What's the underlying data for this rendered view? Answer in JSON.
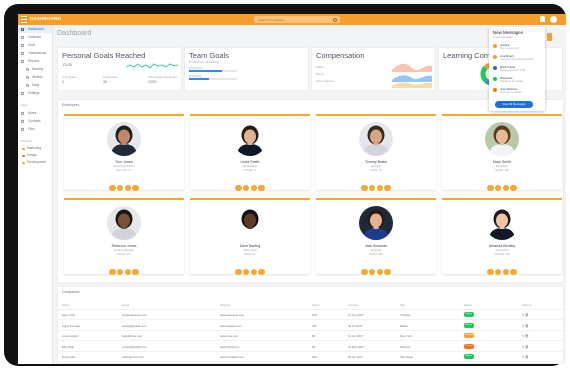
{
  "app": {
    "logo": "DASHBOARD",
    "search_placeholder": "Search for anything...",
    "page_title": "Dashboard"
  },
  "colors": {
    "accent": "#f59e2a",
    "primary": "#1d6fe0",
    "success": "#22c55e",
    "warning": "#f59e2a",
    "danger": "#f97316"
  },
  "sidebar": {
    "items": [
      {
        "label": "Dashboard",
        "icon": "home-icon"
      },
      {
        "label": "Calendar",
        "icon": "calendar-icon"
      },
      {
        "label": "Chat",
        "icon": "chat-icon"
      },
      {
        "label": "Transactions",
        "icon": "card-icon"
      },
      {
        "label": "Reports",
        "icon": "chart-icon"
      }
    ],
    "sub_items": [
      "Monthly",
      "Weekly",
      "Daily"
    ],
    "after_items": [
      {
        "label": "Settings",
        "icon": "gear-icon"
      }
    ],
    "apps_head": "Apps",
    "apps": [
      {
        "label": "Notes",
        "icon": "note-icon"
      },
      {
        "label": "Contacts",
        "icon": "contact-icon"
      },
      {
        "label": "Files",
        "icon": "file-icon"
      }
    ],
    "projects_head": "Projects",
    "projects": [
      {
        "label": "Marketing",
        "color": "#f59e2a"
      },
      {
        "label": "Design",
        "color": "#f97316"
      },
      {
        "label": "Development",
        "color": "#eab308"
      }
    ]
  },
  "kpis": {
    "goals": {
      "title": "Personal Goals Reached",
      "value": "13/35",
      "stats": [
        {
          "label": "In Progress",
          "value": "4"
        },
        {
          "label": "Total Goals",
          "value": "35"
        },
        {
          "label": "Percentage Completed",
          "value": "100%"
        }
      ]
    },
    "team": {
      "title": "Team Goals",
      "subtitle": "Production / Marketing",
      "bars": [
        {
          "label": "Production",
          "fill": 0.68
        },
        {
          "label": "Marketing",
          "fill": 0.42
        }
      ]
    },
    "compensation": {
      "title": "Compensation",
      "rows": [
        "Salary",
        "Bonus",
        "Stock Options"
      ]
    },
    "learning": {
      "title": "Learning Completed"
    }
  },
  "notifications": {
    "title": "New Messages",
    "subtitle": "5 new messages",
    "items": [
      {
        "title": "Jessica",
        "sub": "Hey, how are you?",
        "color": "#f59e2a"
      },
      {
        "title": "Lisa Brown",
        "sub": "Can you review this document?",
        "color": "#f59e2a"
      },
      {
        "title": "Mark Tomas",
        "sub": "Meeting moved to 3 PM",
        "color": "#2563eb"
      },
      {
        "title": "Stephanie",
        "sub": "Thanks for the update",
        "color": "#22c55e"
      },
      {
        "title": "Jose Martinez",
        "sub": "Let's sync tomorrow",
        "color": "#f97316"
      }
    ],
    "button": "View All Messages"
  },
  "employees": {
    "title": "Employees",
    "list": [
      {
        "name": "Tom Jones",
        "role": "Marketing Director",
        "loc": "New York, NY",
        "skin": "#c08a6a",
        "hair": "#1f1f1f",
        "shirt": "#1f2937",
        "bg": "#e5e7eb"
      },
      {
        "name": "Linda Smith",
        "role": "HR Manager",
        "loc": "Chicago, IL",
        "skin": "#e0b291",
        "hair": "#2b1b12",
        "shirt": "#0f172a",
        "bg": "#ffffff"
      },
      {
        "name": "Tommy Brake",
        "role": "Designer",
        "loc": "Austin, TX",
        "skin": "#d6a585",
        "hair": "#3b2a1e",
        "shirt": "#d1d5db",
        "bg": "#e5e7eb"
      },
      {
        "name": "Mary Smith",
        "role": "Developer",
        "loc": "Seattle, WA",
        "skin": "#e7b995",
        "hair": "#5b3a22",
        "shirt": "#f3f4f6",
        "bg": "#b7c9a6"
      },
      {
        "name": "Rebecca Jones",
        "role": "Product Manager",
        "loc": "Denver, CO",
        "skin": "#7b5238",
        "hair": "#171717",
        "shirt": "#d1d5db",
        "bg": "#e5e7eb"
      },
      {
        "name": "Dave Barling",
        "role": "Sales Lead",
        "loc": "Miami, FL",
        "skin": "#5e3a26",
        "hair": "#111111",
        "shirt": "#ffffff",
        "bg": "#ffffff"
      },
      {
        "name": "Jack Bowman",
        "role": "Engineer",
        "loc": "Boston, MA",
        "skin": "#e2b293",
        "hair": "#2b1b12",
        "shirt": "#1e3a8a",
        "bg": "#1f2937"
      },
      {
        "name": "Amanda Bentley",
        "role": "Accountant",
        "loc": "Portland, OR",
        "skin": "#efc3a4",
        "hair": "#1a1a1a",
        "shirt": "#111827",
        "bg": "#ffffff"
      }
    ]
  },
  "companies": {
    "title": "Companies",
    "columns": [
      "Name",
      "Email",
      "Website",
      "Users",
      "Created",
      "City",
      "Status",
      "Actions"
    ],
    "rows": [
      {
        "name": "Apex Tech",
        "email": "info@apextech.com",
        "site": "www.apextech.com",
        "users": "120",
        "created": "17 Aug 2017",
        "city": "Chicago",
        "status": "Active",
        "color": "#22c55e"
      },
      {
        "name": "Apple Thunder",
        "email": "team@appleth.com",
        "site": "www.appleth.com",
        "users": "245",
        "created": "02 Jul 2017",
        "city": "Dallas",
        "status": "Active",
        "color": "#22c55e"
      },
      {
        "name": "Luna Loafers",
        "email": "hello@luna.com",
        "site": "www.luna.com",
        "users": "66",
        "created": "11 Jun 2017",
        "city": "New York",
        "status": "Pending",
        "color": "#f59e2a"
      },
      {
        "name": "Blue Shift",
        "email": "contact@bshift.com",
        "site": "www.bshift.com",
        "users": "98",
        "created": "24 May 2017",
        "city": "Phoenix",
        "status": "Closed",
        "color": "#f97316"
      },
      {
        "name": "Nova Labs",
        "email": "office@nova.com",
        "site": "www.novalabs.com",
        "users": "310",
        "created": "09 Apr 2017",
        "city": "San Diego",
        "status": "Active",
        "color": "#22c55e"
      }
    ]
  }
}
